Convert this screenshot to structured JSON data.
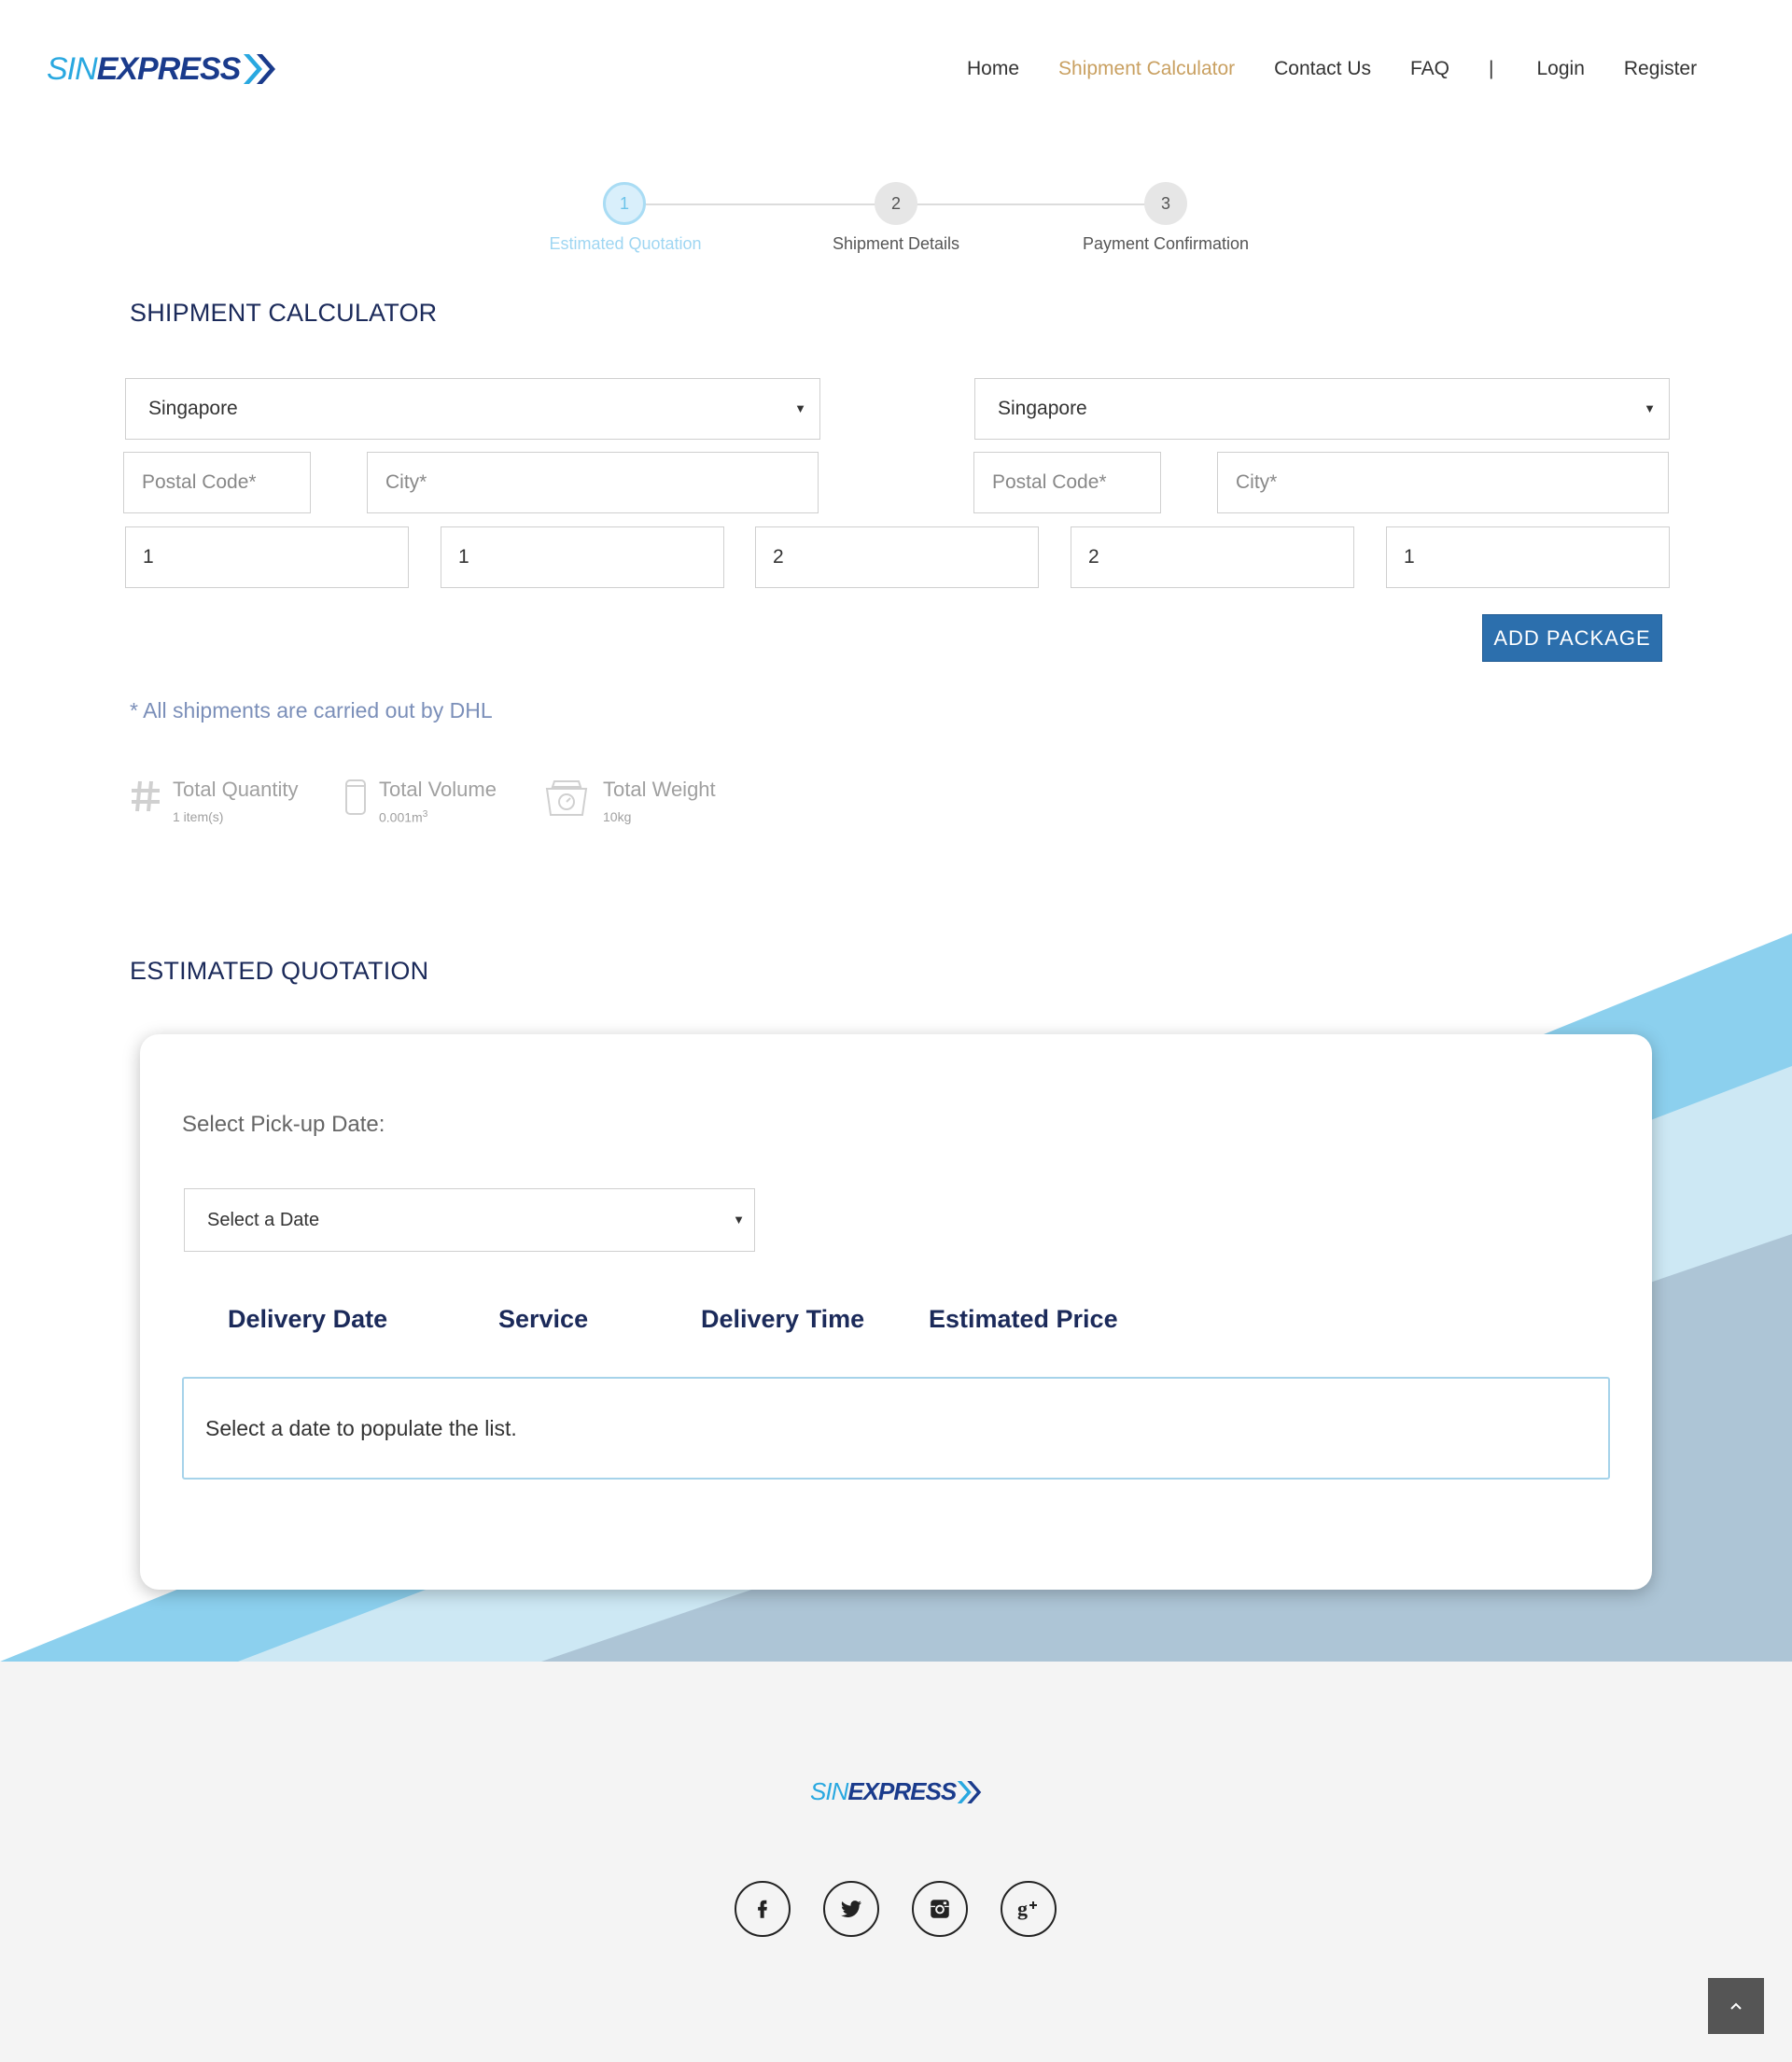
{
  "brand": {
    "sin": "SIN",
    "express": "EXPRESS"
  },
  "nav": {
    "items": [
      {
        "label": "Home"
      },
      {
        "label": "Shipment Calculator",
        "active": true
      },
      {
        "label": "Contact Us"
      },
      {
        "label": "FAQ"
      }
    ],
    "separator": "|",
    "login": "Login",
    "register": "Register"
  },
  "stepper": {
    "steps": [
      {
        "number": "1",
        "label": "Estimated Quotation",
        "active": true
      },
      {
        "number": "2",
        "label": "Shipment Details"
      },
      {
        "number": "3",
        "label": "Payment Confirmation"
      }
    ]
  },
  "calculator": {
    "title": "SHIPMENT CALCULATOR",
    "origin": {
      "country": "Singapore",
      "postal_placeholder": "Postal Code*",
      "city_placeholder": "City*"
    },
    "destination": {
      "country": "Singapore",
      "postal_placeholder": "Postal Code*",
      "city_placeholder": "City*"
    },
    "package_fields": [
      "1",
      "1",
      "2",
      "2",
      "1"
    ],
    "add_package": "ADD PACKAGE",
    "note": "* All shipments are carried out by DHL"
  },
  "summary": {
    "quantity": {
      "label": "Total Quantity",
      "value": "1 item(s)"
    },
    "volume": {
      "label": "Total Volume",
      "value": "0.001m",
      "superscript": "3"
    },
    "weight": {
      "label": "Total Weight",
      "value": "10kg"
    }
  },
  "quotation": {
    "title": "ESTIMATED QUOTATION",
    "pickup_label": "Select Pick-up Date:",
    "date_select": "Select a Date",
    "columns": [
      "Delivery Date",
      "Service",
      "Delivery Time",
      "Estimated Price"
    ],
    "empty_message": "Select a date to populate the list."
  },
  "colors": {
    "accent": "#c9a061",
    "brand_blue": "#1a3b8c",
    "brand_light_blue": "#29a8e0",
    "button": "#2c6fad",
    "heading": "#1b2a5a",
    "band_light": "#cde8f4",
    "band_mid": "#8cd0ee",
    "band_grey": "#adc5d6"
  },
  "icons": {
    "social": [
      "facebook-icon",
      "twitter-icon",
      "instagram-icon",
      "google-plus-icon"
    ]
  }
}
